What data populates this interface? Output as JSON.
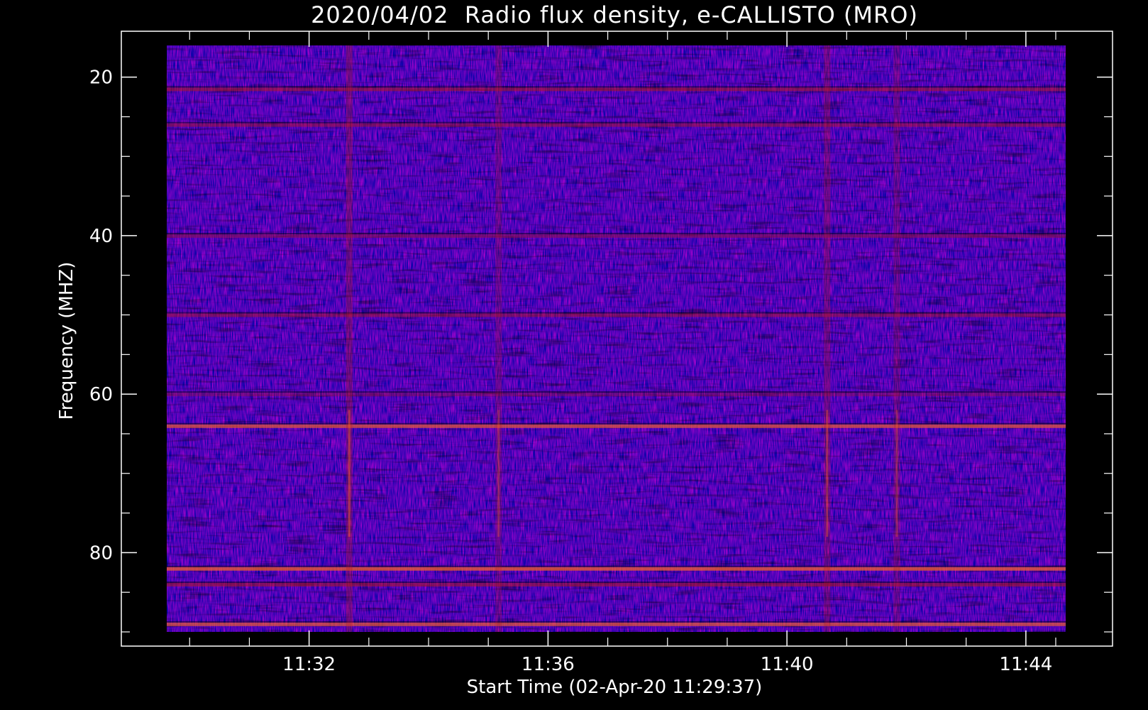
{
  "chart_data": {
    "type": "heatmap",
    "title": "2020/04/02  Radio flux density, e-CALLISTO (MRO)",
    "xlabel": "Start Time (02-Apr-20 11:29:37)",
    "ylabel": "Frequency (MHZ)",
    "x": {
      "unit": "time",
      "range": [
        "11:29:37",
        "11:44:40"
      ],
      "major_ticks": [
        "11:32",
        "11:36",
        "11:40",
        "11:44"
      ],
      "minor_ticks": [
        "11:30",
        "11:31",
        "11:33",
        "11:34",
        "11:35",
        "11:37",
        "11:38",
        "11:39",
        "11:41",
        "11:42",
        "11:43",
        "11:44:30"
      ]
    },
    "y": {
      "unit": "MHz",
      "range": [
        16,
        90
      ],
      "inverted": true,
      "major_ticks": [
        20,
        40,
        60,
        80
      ],
      "minor_ticks": [
        25,
        30,
        35,
        45,
        50,
        55,
        65,
        70,
        75,
        85,
        90
      ]
    },
    "colormap": [
      "#000000",
      "#1a10c8",
      "#3a18f0",
      "#6a1aa8",
      "#b01818",
      "#ff6a1a",
      "#ffd060"
    ],
    "background": "#000000",
    "features": [
      {
        "kind": "horizontal_band",
        "freq_mhz": 21.5,
        "strength": 0.7
      },
      {
        "kind": "horizontal_band",
        "freq_mhz": 26,
        "strength": 0.6
      },
      {
        "kind": "horizontal_band",
        "freq_mhz": 40,
        "strength": 0.5
      },
      {
        "kind": "horizontal_band",
        "freq_mhz": 50,
        "strength": 0.6
      },
      {
        "kind": "horizontal_band",
        "freq_mhz": 60,
        "strength": 0.4
      },
      {
        "kind": "horizontal_band",
        "freq_mhz": 64,
        "strength": 0.8
      },
      {
        "kind": "horizontal_band",
        "freq_mhz": 82,
        "strength": 0.9
      },
      {
        "kind": "horizontal_band",
        "freq_mhz": 84,
        "strength": 0.7
      },
      {
        "kind": "horizontal_band",
        "freq_mhz": 89,
        "strength": 0.8
      },
      {
        "kind": "vertical_burst",
        "time": "11:32:40",
        "strength": 0.7
      },
      {
        "kind": "vertical_burst",
        "time": "11:35:10",
        "strength": 0.5
      },
      {
        "kind": "vertical_burst",
        "time": "11:40:40",
        "strength": 0.6
      },
      {
        "kind": "vertical_burst",
        "time": "11:41:50",
        "strength": 0.5
      }
    ]
  }
}
